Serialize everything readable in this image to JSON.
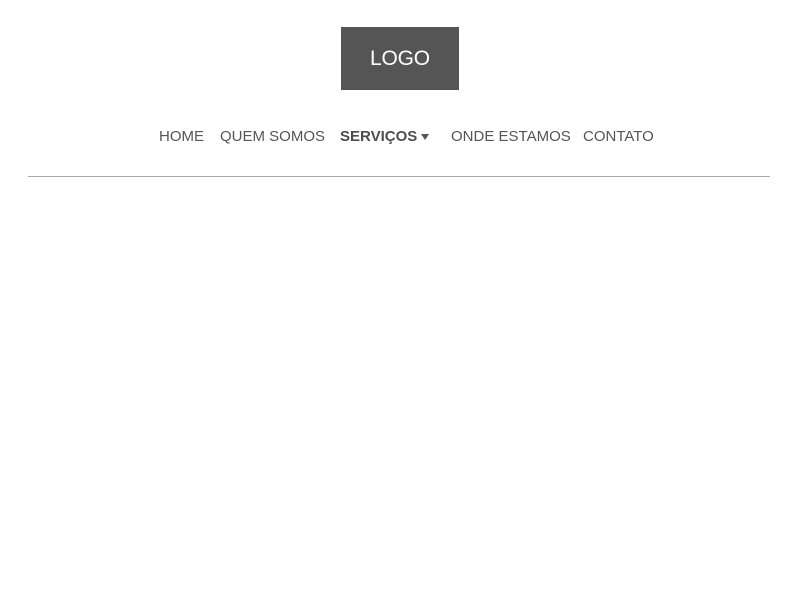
{
  "header": {
    "logo_text": "LOGO"
  },
  "nav": {
    "items": [
      {
        "label": "HOME",
        "active": false
      },
      {
        "label": "QUEM SOMOS",
        "active": false
      },
      {
        "label": "SERVIÇOS",
        "active": true,
        "has_dropdown": true
      },
      {
        "label": "ONDE ESTAMOS",
        "active": false
      },
      {
        "label": "CONTATO",
        "active": false
      }
    ]
  },
  "colors": {
    "logo_background": "#555555",
    "logo_text": "#ffffff",
    "nav_text": "#555555",
    "divider": "#a8a8a8",
    "page_background": "#ffffff"
  }
}
